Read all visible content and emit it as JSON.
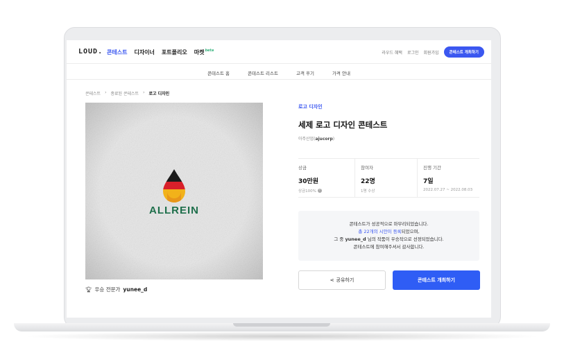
{
  "nav": {
    "logo": "LOUD.",
    "links": [
      "콘테스트",
      "디자이너",
      "포트폴리오",
      "마켓"
    ],
    "beta": "beta",
    "right": [
      "라우드 혜택",
      "로그인",
      "회원가입"
    ],
    "cta": "콘테스트 개최하기"
  },
  "subnav": [
    "콘테스트 홈",
    "콘테스트 리스트",
    "고객 후기",
    "가격 안내"
  ],
  "breadcrumb": [
    "콘테스트",
    "종료된 콘테스트",
    "로고 디자인"
  ],
  "poster": {
    "brand_text": "ALLREIN"
  },
  "caption": {
    "prefix": "우승 전문가",
    "name": "yunee_d"
  },
  "contest": {
    "category": "로고 디자인",
    "title": "세제 로고 디자인 콘테스트",
    "company_name": "아주산업",
    "company_id": "ajucorp"
  },
  "stats": [
    {
      "label": "상금",
      "value": "30만원",
      "sub": "상금100%"
    },
    {
      "label": "참여자",
      "value": "22명",
      "sub": "1명 수상"
    },
    {
      "label": "진행 기간",
      "value": "7일",
      "sub": "2022.07.27 ~ 2022.08.03"
    }
  ],
  "notice": {
    "line1": "콘테스트가 성공적으로 마무리되었습니다.",
    "line2_blue": "총 22개의 시안이 등록",
    "line2_rest": "되었으며,",
    "line3_pre": "그 중",
    "line3_name": "yunee_d",
    "line3_post": "님의 작품이 우승작으로 선정되었습니다.",
    "line4": "콘테스트에 참여해주셔서 감사합니다."
  },
  "buttons": {
    "share": "공유하기",
    "host": "콘테스트 개최하기"
  },
  "colors": {
    "accent": "#3b57f0",
    "primary_button": "#2f5df5",
    "logo_red": "#d8202a",
    "logo_yellow": "#f2b21a",
    "logo_green": "#1d6e4a"
  }
}
